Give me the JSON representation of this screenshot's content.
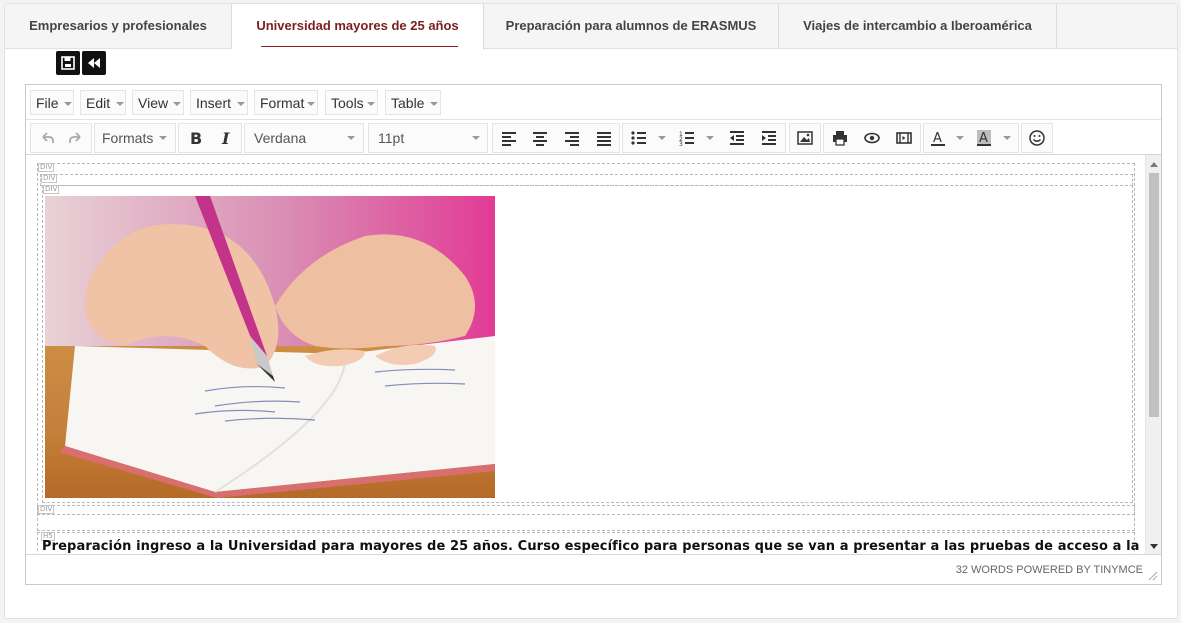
{
  "tabs": [
    {
      "label": "Empresarios y profesionales",
      "active": false
    },
    {
      "label": "Universidad mayores de 25 años",
      "active": true
    },
    {
      "label": "Preparación para alumnos de ERASMUS",
      "active": false
    },
    {
      "label": "Viajes de intercambio a Iberoamérica",
      "active": false
    }
  ],
  "quick_actions": {
    "save_icon": "save-icon",
    "back_icon": "rewind-icon"
  },
  "menubar": [
    "File",
    "Edit",
    "View",
    "Insert",
    "Format",
    "Tools",
    "Table"
  ],
  "toolbar": {
    "formats_label": "Formats",
    "font_family": "Verdana",
    "font_size": "11pt",
    "icons": [
      "undo-icon",
      "redo-icon",
      "bold-icon",
      "italic-icon",
      "align-left-icon",
      "align-center-icon",
      "align-right-icon",
      "align-justify-icon",
      "bullet-list-icon",
      "numbered-list-icon",
      "outdent-icon",
      "indent-icon",
      "image-icon",
      "print-icon",
      "preview-icon",
      "media-icon",
      "text-color-icon",
      "background-color-icon",
      "emoticons-icon"
    ]
  },
  "content": {
    "block_tags": [
      "DIV",
      "DIV",
      "DIV",
      "DIV",
      "H5"
    ],
    "image_alt": "writing-in-notebook-photo",
    "paragraph": "Preparación ingreso a la Universidad para mayores de 25 años. Curso específico para personas que se van a presentar a las pruebas de acceso a la Universidad, para"
  },
  "statusbar": {
    "text": "32 WORDS POWERED BY TINYMCE"
  },
  "colors": {
    "accent": "#7a1e1e",
    "tab_bg": "#f5f5f5",
    "border": "#c9c9c9"
  }
}
